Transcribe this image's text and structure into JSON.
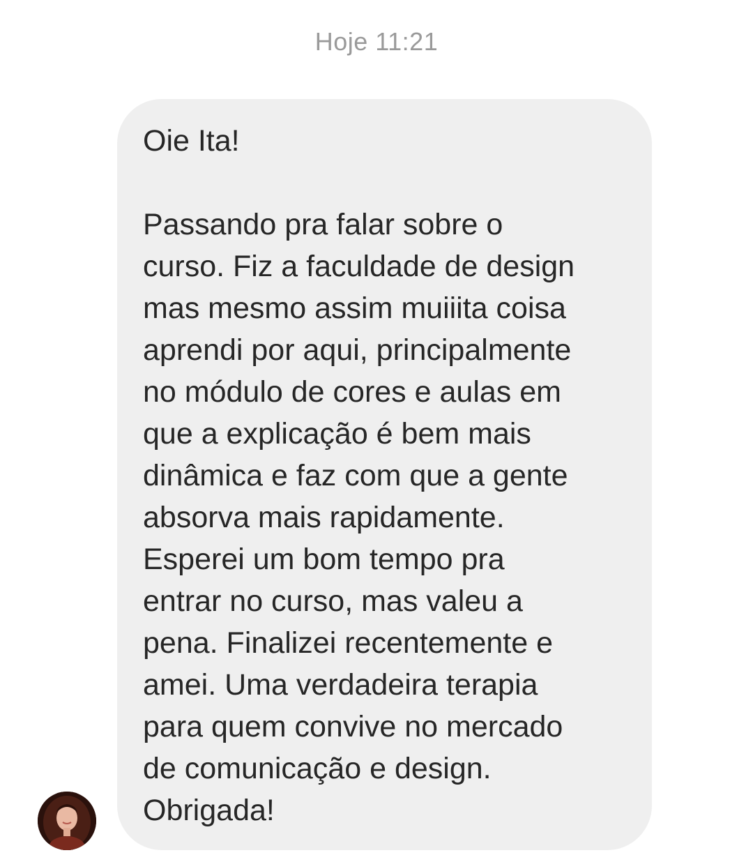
{
  "timestamp": "Hoje 11:21",
  "message": {
    "sender_avatar": "user-avatar",
    "lines": [
      "Oie Ita!",
      "",
      "Passando pra falar sobre o",
      "curso. Fiz a faculdade de design",
      "mas mesmo assim muiiita coisa",
      "aprendi por aqui, principalmente",
      "no módulo de cores e aulas em",
      "que a explicação é bem mais",
      "dinâmica e faz com que a gente",
      "absorva mais rapidamente.",
      "Esperei um bom tempo pra",
      "entrar no curso, mas valeu a",
      "pena. Finalizei recentemente e",
      "amei. Uma verdadeira terapia",
      "para quem convive no mercado",
      "de comunicação e design.",
      "Obrigada!"
    ]
  },
  "colors": {
    "bubble_background": "#efefef",
    "message_text": "#262626",
    "timestamp_text": "#9a9a9a",
    "page_background": "#ffffff"
  }
}
